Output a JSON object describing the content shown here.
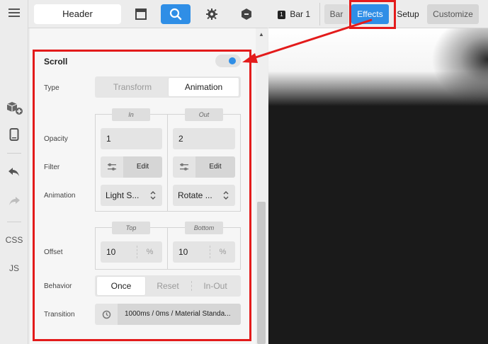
{
  "toolbar": {
    "header_label": "Header"
  },
  "rail": {
    "css_label": "CSS",
    "js_label": "JS"
  },
  "editor_tabs": {
    "bar_badge": "1",
    "bar_tab": "Bar 1",
    "tabs": [
      "Bar",
      "Effects",
      "Setup",
      "Customize"
    ],
    "active_tab": "Effects"
  },
  "panel": {
    "title": "Scroll",
    "toggle_on": true,
    "type": {
      "label": "Type",
      "options": [
        "Transform",
        "Animation"
      ],
      "selected": "Animation"
    },
    "in_label": "In",
    "out_label": "Out",
    "opacity": {
      "label": "Opacity",
      "in": "1",
      "out": "2"
    },
    "filter": {
      "label": "Filter",
      "in_button": "Edit",
      "out_button": "Edit"
    },
    "animation": {
      "label": "Animation",
      "in": "Light S...",
      "out": "Rotate ..."
    },
    "top_label": "Top",
    "bottom_label": "Bottom",
    "offset": {
      "label": "Offset",
      "top": "10",
      "bottom": "10",
      "unit": "%"
    },
    "behavior": {
      "label": "Behavior",
      "options": [
        "Once",
        "Reset",
        "In-Out"
      ],
      "selected": "Once"
    },
    "transition": {
      "label": "Transition",
      "value": "1000ms / 0ms / Material Standa..."
    }
  },
  "colors": {
    "accent": "#2f8ee6",
    "highlight": "#e31b1b"
  }
}
